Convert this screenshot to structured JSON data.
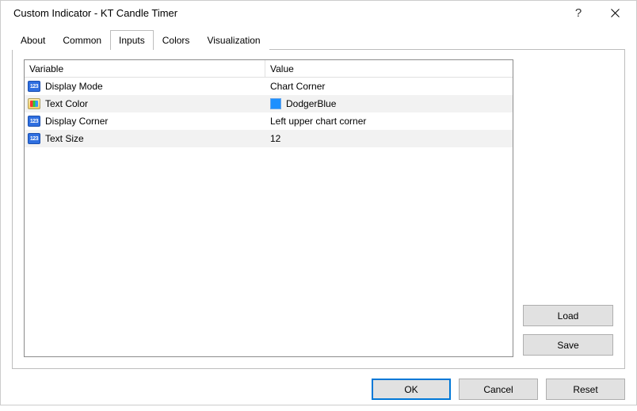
{
  "window": {
    "title": "Custom Indicator - KT Candle Timer"
  },
  "tabs": {
    "about": "About",
    "common": "Common",
    "inputs": "Inputs",
    "colors": "Colors",
    "visualization": "Visualization",
    "active": "inputs"
  },
  "table": {
    "headers": {
      "variable": "Variable",
      "value": "Value"
    },
    "rows": [
      {
        "icon": "123",
        "var": "Display Mode",
        "val": "Chart Corner",
        "swatch": null
      },
      {
        "icon": "color",
        "var": "Text Color",
        "val": "DodgerBlue",
        "swatch": "#1e90ff"
      },
      {
        "icon": "123",
        "var": "Display Corner",
        "val": "Left upper chart corner",
        "swatch": null
      },
      {
        "icon": "123",
        "var": "Text Size",
        "val": "12",
        "swatch": null
      }
    ]
  },
  "buttons": {
    "load": "Load",
    "save": "Save",
    "ok": "OK",
    "cancel": "Cancel",
    "reset": "Reset"
  }
}
